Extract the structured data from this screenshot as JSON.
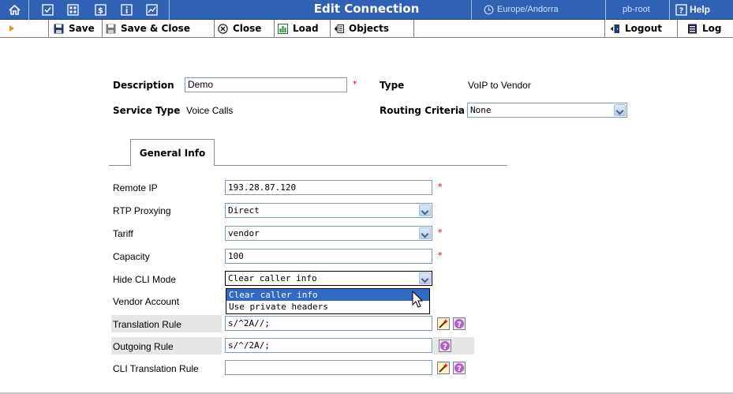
{
  "window": {
    "title": "Edit Connection",
    "timezone": "Europe/Andorra",
    "user": "pb-root",
    "help_label": "Help"
  },
  "toolbar": {
    "save_label": "Save",
    "save_close_label": "Save & Close",
    "close_label": "Close",
    "load_label": "Load",
    "objects_label": "Objects",
    "logout_label": "Logout",
    "log_label": "Log"
  },
  "header_fields": {
    "description_label": "Description",
    "description_value": "Demo",
    "type_label": "Type",
    "type_value": "VoIP to Vendor",
    "service_type_label": "Service Type",
    "service_type_value": "Voice Calls",
    "routing_criteria_label": "Routing Criteria",
    "routing_criteria_value": "None"
  },
  "tabs": [
    {
      "label": "General Info",
      "active": true
    }
  ],
  "general_info": {
    "remote_ip_label": "Remote IP",
    "remote_ip_value": "193.28.87.120",
    "rtp_proxying_label": "RTP Proxying",
    "rtp_proxying_value": "Direct",
    "tariff_label": "Tariff",
    "tariff_value": "vendor",
    "capacity_label": "Capacity",
    "capacity_value": "100",
    "hide_cli_label": "Hide CLI Mode",
    "hide_cli_value": "Clear caller info",
    "hide_cli_options": [
      "Clear caller info",
      "Use private headers"
    ],
    "vendor_account_label": "Vendor Account",
    "translation_rule_label": "Translation Rule",
    "translation_rule_value": "s/^2A//;",
    "outgoing_rule_label": "Outgoing Rule",
    "outgoing_rule_value": "s/^/2A/;",
    "cli_translation_rule_label": "CLI Translation Rule",
    "cli_translation_rule_value": ""
  },
  "required_marker": "*",
  "colors": {
    "titlebar": "#2f62b4",
    "required": "#e00000",
    "selection": "#316ac5"
  }
}
